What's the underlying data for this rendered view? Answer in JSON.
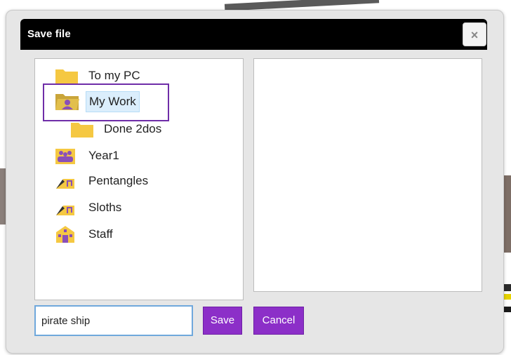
{
  "dialog": {
    "title": "Save file",
    "close_label": "×"
  },
  "tree": {
    "items": [
      {
        "label": "To my PC",
        "icon": "folder-icon"
      },
      {
        "label": "My Work",
        "icon": "user-folder-icon",
        "selected": true
      },
      {
        "label": "Done 2dos",
        "icon": "folder-icon"
      },
      {
        "label": "Year1",
        "icon": "group-icon"
      },
      {
        "label": "Pentangles",
        "icon": "music-folder-icon"
      },
      {
        "label": "Sloths",
        "icon": "music-folder-icon"
      },
      {
        "label": "Staff",
        "icon": "school-icon"
      }
    ]
  },
  "footer": {
    "filename_value": "pirate ship",
    "save_label": "Save",
    "cancel_label": "Cancel"
  },
  "colors": {
    "accent": "#8c2fc8",
    "folder": "#f5c842",
    "selection_outline": "#6f2da8"
  }
}
